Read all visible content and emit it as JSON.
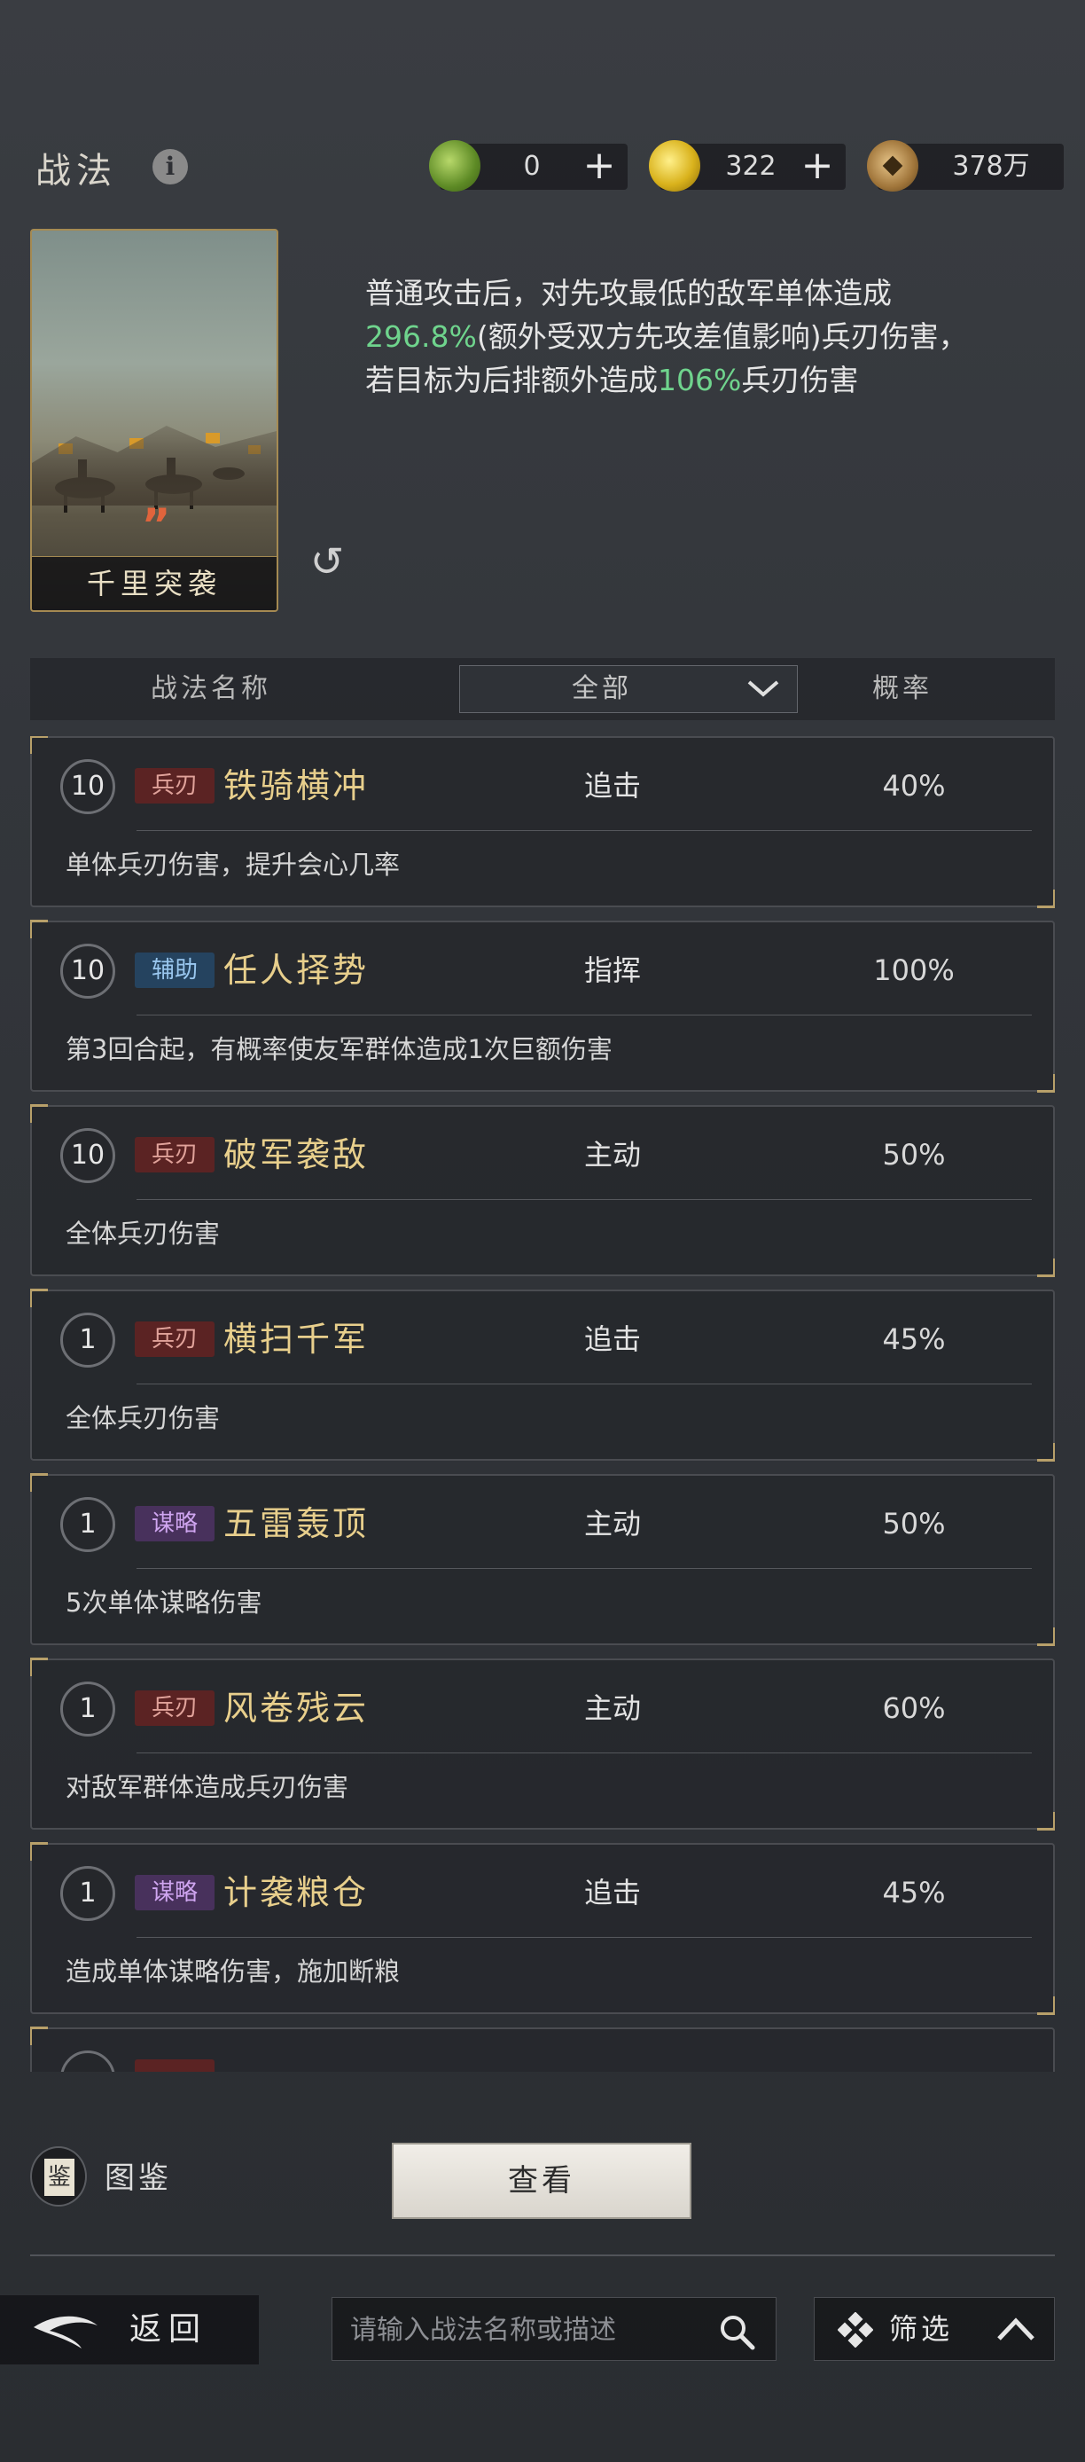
{
  "header": {
    "title": "战法",
    "currencies": [
      {
        "icon": "jade-coin-icon",
        "value": "0",
        "has_plus": true,
        "color": "#7fae3c"
      },
      {
        "icon": "gold-coin-icon",
        "value": "322",
        "has_plus": true,
        "color": "#d9b21c"
      },
      {
        "icon": "copper-coin-icon",
        "value": "378万",
        "has_plus": false,
        "color": "#a0753a"
      }
    ],
    "plus_symbol": "+"
  },
  "detail": {
    "card_name": "千里突袭",
    "card_mark": "”",
    "desc_parts": [
      {
        "text": "普通攻击后，对先攻最低的敌军单体造成",
        "hl": false
      },
      {
        "text": "296.8%",
        "hl": true
      },
      {
        "text": "(额外受双方先攻差值影响)兵刃伤害，若目标为后排额外造成",
        "hl": false
      },
      {
        "text": "106%",
        "hl": true
      },
      {
        "text": "兵刃伤害",
        "hl": false
      }
    ],
    "highlight_color": "#6fd48d"
  },
  "list_header": {
    "name_col": "战法名称",
    "filter_value": "全部",
    "prob_col": "概率"
  },
  "skills": [
    {
      "level": "10",
      "tag": "兵刃",
      "tag_style": "red",
      "name": "铁骑横冲",
      "type": "追击",
      "prob": "40%",
      "desc": "单体兵刃伤害，提升会心几率"
    },
    {
      "level": "10",
      "tag": "辅助",
      "tag_style": "blue",
      "name": "任人择势",
      "type": "指挥",
      "prob": "100%",
      "desc": "第3回合起，有概率使友军群体造成1次巨额伤害"
    },
    {
      "level": "10",
      "tag": "兵刃",
      "tag_style": "red",
      "name": "破军袭敌",
      "type": "主动",
      "prob": "50%",
      "desc": "全体兵刃伤害"
    },
    {
      "level": "1",
      "tag": "兵刃",
      "tag_style": "red",
      "name": "横扫千军",
      "type": "追击",
      "prob": "45%",
      "desc": "全体兵刃伤害"
    },
    {
      "level": "1",
      "tag": "谋略",
      "tag_style": "purple",
      "name": "五雷轰顶",
      "type": "主动",
      "prob": "50%",
      "desc": "5次单体谋略伤害"
    },
    {
      "level": "1",
      "tag": "兵刃",
      "tag_style": "red",
      "name": "风卷残云",
      "type": "主动",
      "prob": "60%",
      "desc": "对敌军群体造成兵刃伤害"
    },
    {
      "level": "1",
      "tag": "谋略",
      "tag_style": "purple",
      "name": "计袭粮仓",
      "type": "追击",
      "prob": "45%",
      "desc": "造成单体谋略伤害，施加断粮"
    },
    {
      "level": "",
      "tag": "",
      "tag_style": "red",
      "name": "",
      "type": "",
      "prob": "",
      "desc": ""
    }
  ],
  "bottom": {
    "codex_icon_char": "鉴",
    "codex_label": "图鉴",
    "view_button": "查看",
    "back_label": "返回",
    "search_placeholder": "请输入战法名称或描述",
    "filter_label": "筛选"
  }
}
